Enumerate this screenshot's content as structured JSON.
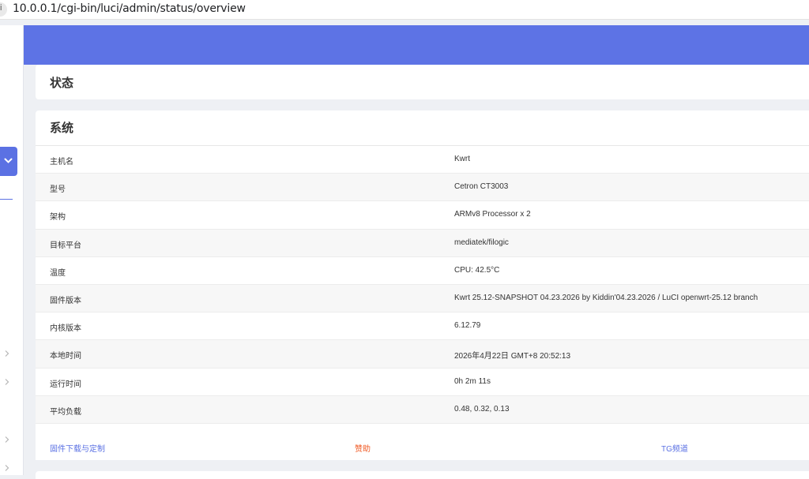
{
  "address_bar": {
    "url": "10.0.0.1/cgi-bin/luci/admin/status/overview"
  },
  "page": {
    "title": "状态"
  },
  "system": {
    "title": "系统",
    "rows": [
      {
        "key": "主机名",
        "value": "Kwrt"
      },
      {
        "key": "型号",
        "value": "Cetron CT3003"
      },
      {
        "key": "架构",
        "value": "ARMv8 Processor x 2"
      },
      {
        "key": "目标平台",
        "value": "mediatek/filogic"
      },
      {
        "key": "温度",
        "value": "CPU: 42.5°C"
      },
      {
        "key": "固件版本",
        "value": "Kwrt 25.12-SNAPSHOT 04.23.2026 by Kiddin'04.23.2026 / LuCI openwrt-25.12 branch"
      },
      {
        "key": "内核版本",
        "value": "6.12.79"
      },
      {
        "key": "本地时间",
        "value": "2026年4月22日 GMT+8 20:52:13"
      },
      {
        "key": "运行时间",
        "value": "0h 2m 11s"
      },
      {
        "key": "平均负载",
        "value": "0.48, 0.32, 0.13"
      }
    ],
    "links": [
      {
        "label": "固件下载与定制",
        "color": "#5b71e3"
      },
      {
        "label": "赞助",
        "color": "#f05a24"
      },
      {
        "label": "TG频道",
        "color": "#5b71e3"
      }
    ]
  },
  "colors": {
    "accent": "#5d73e5",
    "link": "#5b71e3",
    "sponsor": "#f05a24"
  },
  "icons": {
    "sidebar_toggle": "chevron-down-icon",
    "sidebar_expand": "chevron-right-icon"
  }
}
